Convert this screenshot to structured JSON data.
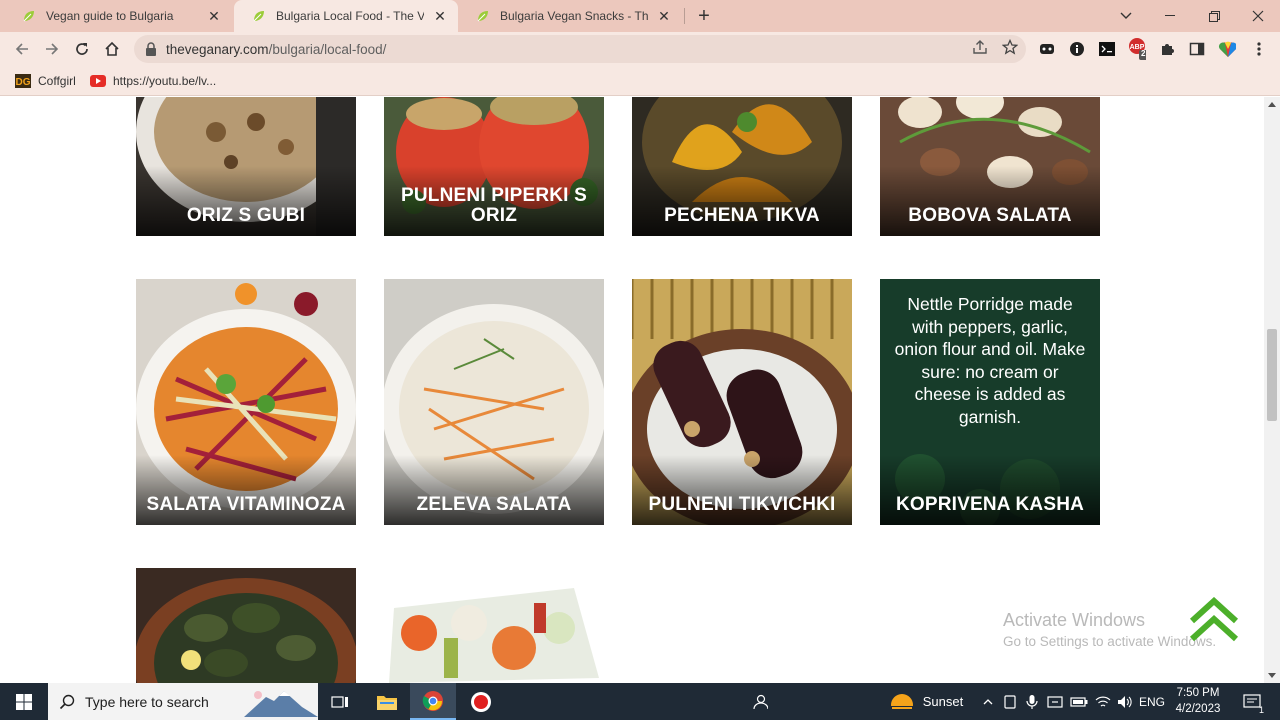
{
  "browser": {
    "tabs": [
      {
        "title": "Vegan guide to Bulgaria",
        "active": false
      },
      {
        "title": "Bulgaria Local Food - The Veganary",
        "active": true
      },
      {
        "title": "Bulgaria Vegan Snacks - The Veganary",
        "active": false
      }
    ],
    "url_host": "theveganary.com",
    "url_path": "/bulgaria/local-food/",
    "bookmarks": [
      {
        "label": "Coffgirl",
        "icon": "coffgirl-icon"
      },
      {
        "label": "https://youtu.be/lv...",
        "icon": "youtube-icon"
      }
    ],
    "extension_badge": "2"
  },
  "page": {
    "foods": [
      {
        "name": "ORIZ S GUBI"
      },
      {
        "name": "PULNENI PIPERKI S ORIZ"
      },
      {
        "name": "PECHENA TIKVA"
      },
      {
        "name": "BOBOVA SALATA"
      },
      {
        "name": "SALATA VITAMINOZA"
      },
      {
        "name": "ZELEVA SALATA"
      },
      {
        "name": "PULNENI TIKVICHKI"
      },
      {
        "name": "KOPRIVENA KASHA",
        "hover_text": "Nettle Porridge made with peppers, garlic, onion flour and oil. Make sure: no cream or cheese is added as garnish."
      },
      {
        "name": ""
      },
      {
        "name": ""
      }
    ],
    "accent_color": "#4caf2a"
  },
  "watermark": {
    "line1": "Activate Windows",
    "line2": "Go to Settings to activate Windows."
  },
  "taskbar": {
    "search_placeholder": "Type here to search",
    "weather": "Sunset",
    "language": "ENG",
    "time": "7:50 PM",
    "date": "4/2/2023",
    "notification_count": "1"
  }
}
